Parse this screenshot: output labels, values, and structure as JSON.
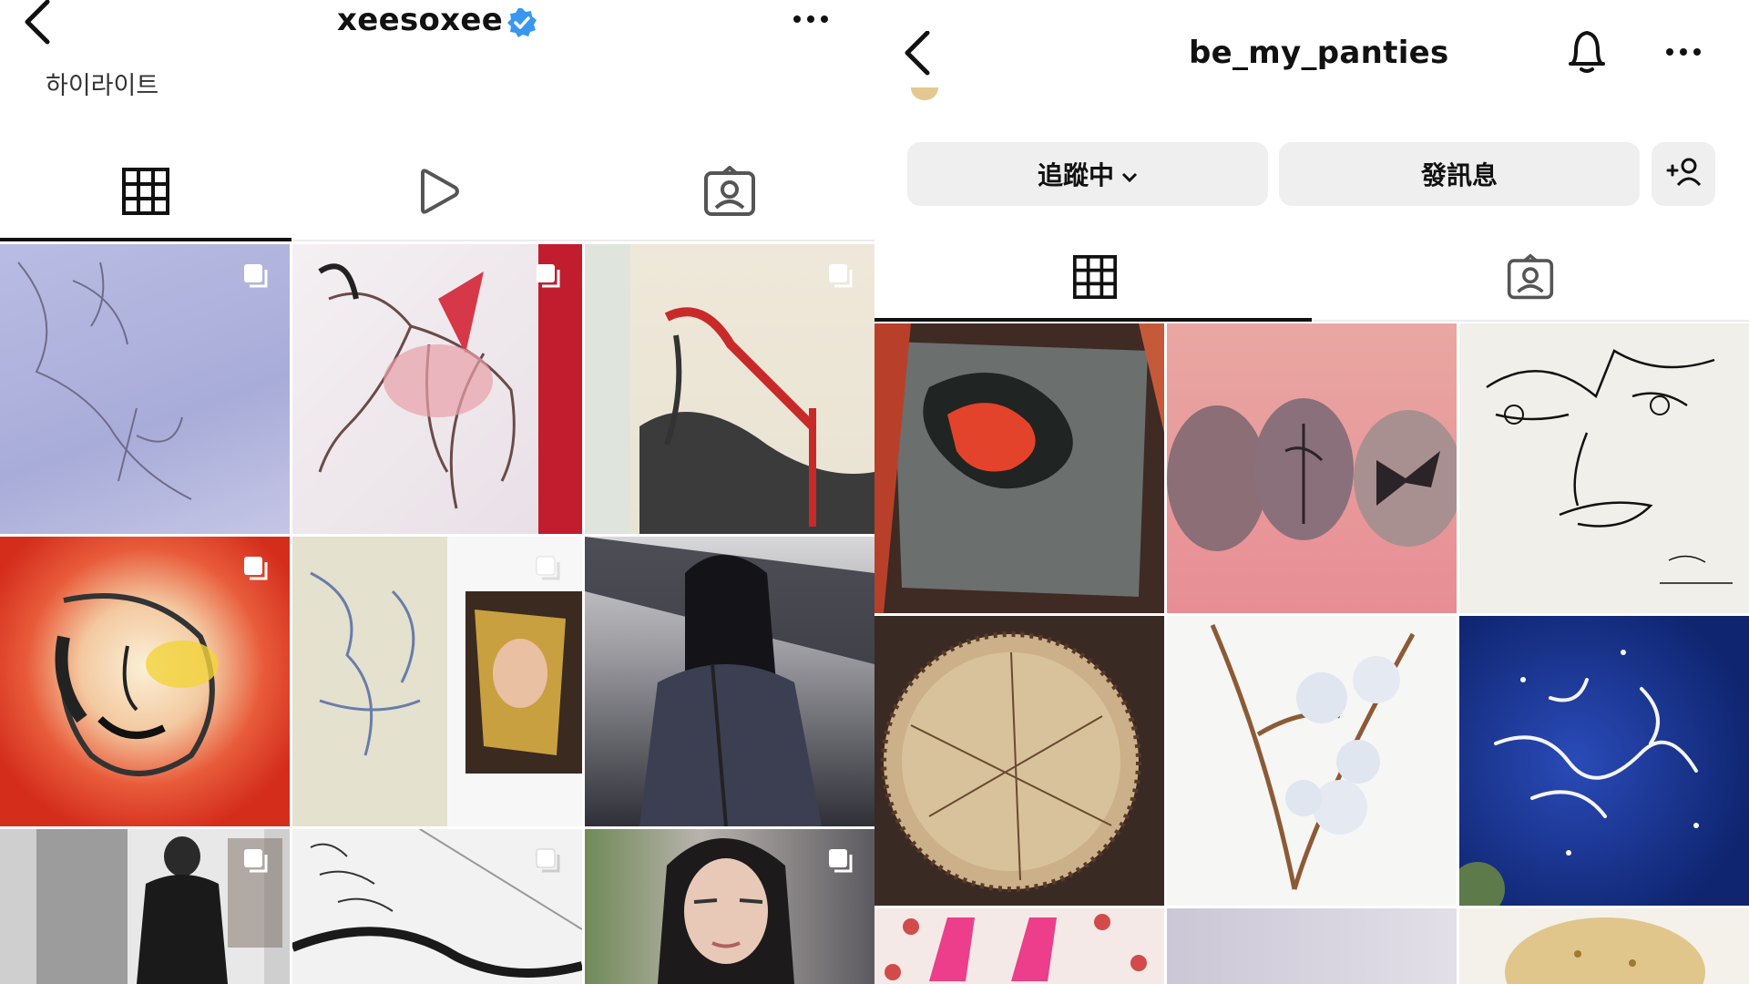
{
  "left_profile": {
    "username": "xeesoxee",
    "verified": true,
    "section_label": "하이라이트",
    "tabs": [
      "grid-icon",
      "reels-icon",
      "tagged-icon"
    ],
    "active_tab": 0,
    "multi_post_indicator_on_tiles": true
  },
  "right_profile": {
    "username": "be_my_panties",
    "following_label": "追蹤中",
    "message_label": "發訊息",
    "tabs": [
      "grid-icon",
      "tagged-icon"
    ],
    "active_tab": 0
  },
  "colors": {
    "background": "#ffffff",
    "button_bg": "#efefef",
    "verified_blue": "#3897f0",
    "text": "#111111"
  }
}
